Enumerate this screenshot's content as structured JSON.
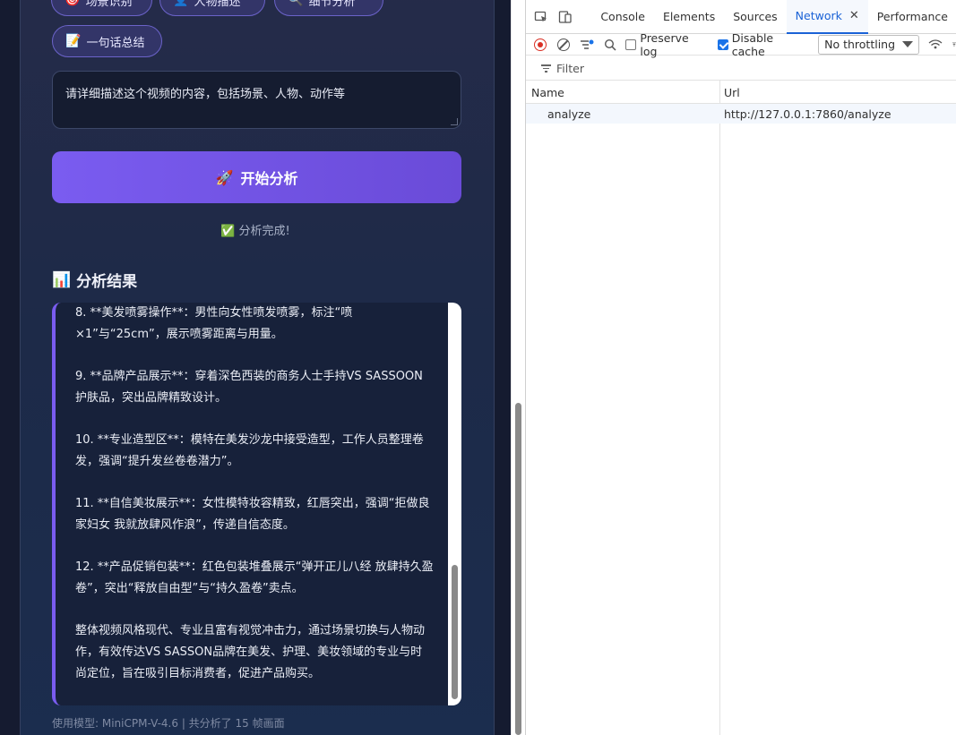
{
  "app": {
    "chips_top": [
      {
        "emoji": "🎯",
        "label": "场景识别"
      },
      {
        "emoji": "👤",
        "label": "人物描述"
      },
      {
        "emoji": "🔍",
        "label": "细节分析"
      }
    ],
    "chip_summary": {
      "emoji": "📝",
      "label": "一句话总结"
    },
    "prompt_value": "请详细描述这个视频的内容，包括场景、人物、动作等",
    "analyze_button": {
      "emoji": "🚀",
      "label": "开始分析"
    },
    "status": {
      "emoji": "✅",
      "text": "分析完成!"
    },
    "result_heading": {
      "emoji": "📊",
      "text": "分析结果"
    },
    "result_paragraphs": [
      "8. **美发喷雾操作**：男性向女性喷发喷雾，标注“喷×1”与“25cm”，展示喷雾距离与用量。",
      "9. **品牌产品展示**：穿着深色西装的商务人士手持VS SASSOON护肤品，突出品牌精致设计。",
      "10. **专业造型区**：模特在美发沙龙中接受造型，工作人员整理卷发，强调“提升发丝卷卷潜力”。",
      "11. **自信美妆展示**：女性模特妆容精致，红唇突出，强调“拒做良家妇女 我就放肆风作浪”，传递自信态度。",
      "12. **产品促销包装**：红色包装堆叠展示“弹开正儿八经 放肆持久盈卷”，突出“释放自由型”与“持久盈卷”卖点。",
      "整体视频风格现代、专业且富有视觉冲击力，通过场景切换与人物动作，有效传达VS SASSON品牌在美发、护理、美妆领域的专业与时尚定位，旨在吸引目标消费者，促进产品购买。"
    ],
    "footer": "使用模型: MiniCPM-V-4.6 | 共分析了 15 帧画面"
  },
  "devtools": {
    "tabs": [
      {
        "label": "Console",
        "active": false
      },
      {
        "label": "Elements",
        "active": false
      },
      {
        "label": "Sources",
        "active": false
      },
      {
        "label": "Network",
        "active": true
      },
      {
        "label": "Performance",
        "active": false
      }
    ],
    "toolbar": {
      "preserve_log_label": "Preserve log",
      "preserve_log_checked": false,
      "disable_cache_label": "Disable cache",
      "disable_cache_checked": true,
      "throttling_value": "No throttling"
    },
    "filter_label": "Filter",
    "columns": [
      "Name",
      "Url"
    ],
    "rows": [
      {
        "name": "analyze",
        "url": "http://127.0.0.1:7860/analyze"
      }
    ]
  },
  "colors": {
    "accent": "#7a5cf0",
    "devtools_active": "#1a62d6",
    "record_red": "#d93025"
  }
}
